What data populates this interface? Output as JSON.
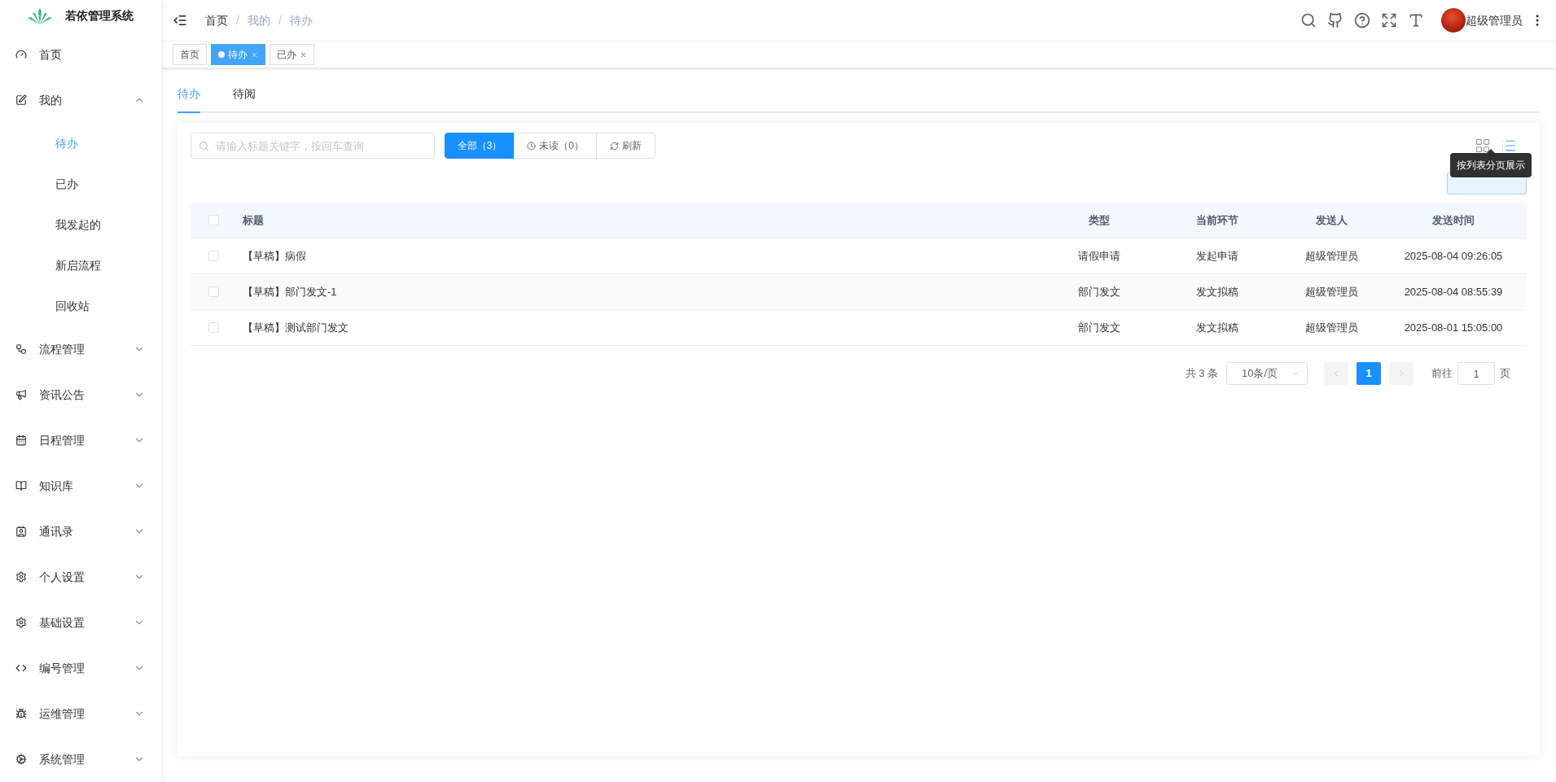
{
  "brand": {
    "title": "若依管理系统"
  },
  "sidebar": {
    "items": [
      {
        "label": "首页",
        "selected": false
      },
      {
        "label": "我的",
        "selected": false,
        "expanded": true,
        "children": [
          {
            "label": "待办",
            "selected": true
          },
          {
            "label": "已办",
            "selected": false
          },
          {
            "label": "我发起的",
            "selected": false
          },
          {
            "label": "新启流程",
            "selected": false
          },
          {
            "label": "回收站",
            "selected": false
          }
        ]
      },
      {
        "label": "流程管理",
        "selected": false,
        "expanded": false
      },
      {
        "label": "资讯公告",
        "selected": false,
        "expanded": false
      },
      {
        "label": "日程管理",
        "selected": false,
        "expanded": false
      },
      {
        "label": "知识库",
        "selected": false,
        "expanded": false
      },
      {
        "label": "通讯录",
        "selected": false,
        "expanded": false
      },
      {
        "label": "个人设置",
        "selected": false,
        "expanded": false
      },
      {
        "label": "基础设置",
        "selected": false,
        "expanded": false
      },
      {
        "label": "编号管理",
        "selected": false,
        "expanded": false
      },
      {
        "label": "运维管理",
        "selected": false,
        "expanded": false
      },
      {
        "label": "系统管理",
        "selected": false,
        "expanded": false
      }
    ]
  },
  "breadcrumb": [
    {
      "kind": "link",
      "label": "首页"
    },
    {
      "kind": "separator",
      "label": "/"
    },
    {
      "kind": "link",
      "label": "我的"
    },
    {
      "kind": "separator",
      "label": "/"
    },
    {
      "kind": "current",
      "label": "待办"
    }
  ],
  "user": {
    "name": "超级管理员"
  },
  "tags": [
    {
      "label": "首页",
      "selected": false,
      "closable": false
    },
    {
      "label": "待办",
      "selected": true,
      "closable": true
    },
    {
      "label": "已办",
      "selected": false,
      "closable": true
    }
  ],
  "page_tabs": [
    {
      "label": "待办",
      "selected": true
    },
    {
      "label": "待阅",
      "selected": false
    }
  ],
  "search": {
    "placeholder": "请输入标题关键字，按回车查询"
  },
  "filters": [
    {
      "kind": "filter",
      "label": "全部（3）",
      "selected": true
    },
    {
      "kind": "unread",
      "label": "未读（0）",
      "selected": false
    },
    {
      "kind": "refresh",
      "label": "刷新",
      "selected": false
    }
  ],
  "view_modes": [
    {
      "kind": "grid",
      "selected": false
    },
    {
      "kind": "list",
      "selected": true
    }
  ],
  "tooltip": "按列表分页展示",
  "table": {
    "all_checked": false,
    "columns": [
      "标题",
      "类型",
      "当前环节",
      "发送人",
      "发送时间"
    ],
    "rows": [
      {
        "checked": false,
        "cells": [
          "【草稿】病假",
          "请假申请",
          "发起申请",
          "超级管理员",
          "2025-08-04 09:26:05"
        ]
      },
      {
        "checked": false,
        "cells": [
          "【草稿】部门发文-1",
          "部门发文",
          "发文拟稿",
          "超级管理员",
          "2025-08-04 08:55:39"
        ]
      },
      {
        "checked": false,
        "cells": [
          "【草稿】测试部门发文",
          "部门发文",
          "发文拟稿",
          "超级管理员",
          "2025-08-01 15:05:00"
        ]
      }
    ]
  },
  "pagination": {
    "total": "共 3 条",
    "page_size": "10条/页",
    "pages": [
      {
        "label": "1",
        "selected": true
      }
    ],
    "goto_label": "前往",
    "goto_value": "1",
    "goto_suffix": "页"
  }
}
